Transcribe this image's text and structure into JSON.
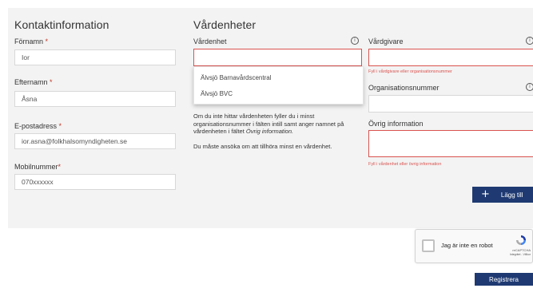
{
  "contact": {
    "title": "Kontaktinformation",
    "first_name": {
      "label": "Förnamn",
      "required": "*",
      "value": "Ior"
    },
    "last_name": {
      "label": "Efternamn",
      "required": "*",
      "value": "Åsna"
    },
    "email": {
      "label": "E-postadress",
      "required": "*",
      "value": "ior.asna@folkhalsomyndigheten.se"
    },
    "mobile": {
      "label": "Mobilnummer",
      "required": "*",
      "value": "070xxxxxx"
    }
  },
  "units": {
    "title": "Vårdenheter",
    "unit_label": "Vårdenhet",
    "unit_value": "",
    "dropdown_options": [
      "Älvsjö Barnavårdscentral",
      "Älvsjö BVC"
    ],
    "help_text_1": "Om du inte hittar vårdenheten fyller du i minst organisationsnummer i fälten intill samt anger namnet på vårdenheten i fältet",
    "help_text_1_em": "Övrig information.",
    "help_text_2": "Du måste ansöka om att tillhöra minst en vårdenhet.",
    "provider_label": "Vårdgivare",
    "provider_error": "Fyll i vårdgivare eller organisationsnummer",
    "org_label": "Organisationsnummer",
    "other_label": "Övrig information",
    "other_error": "Fyll i vårdenhet eller övrig information",
    "add_button": "Lägg till",
    "add_icon": "plus-icon"
  },
  "captcha": {
    "label": "Jag är inte en robot",
    "brand": "reCAPTCHA",
    "links": "Integritet - Villkor"
  },
  "register_button": "Registrera",
  "colors": {
    "primary": "#1f3a72",
    "error": "#d9534f",
    "panel": "#f3f3f3"
  }
}
